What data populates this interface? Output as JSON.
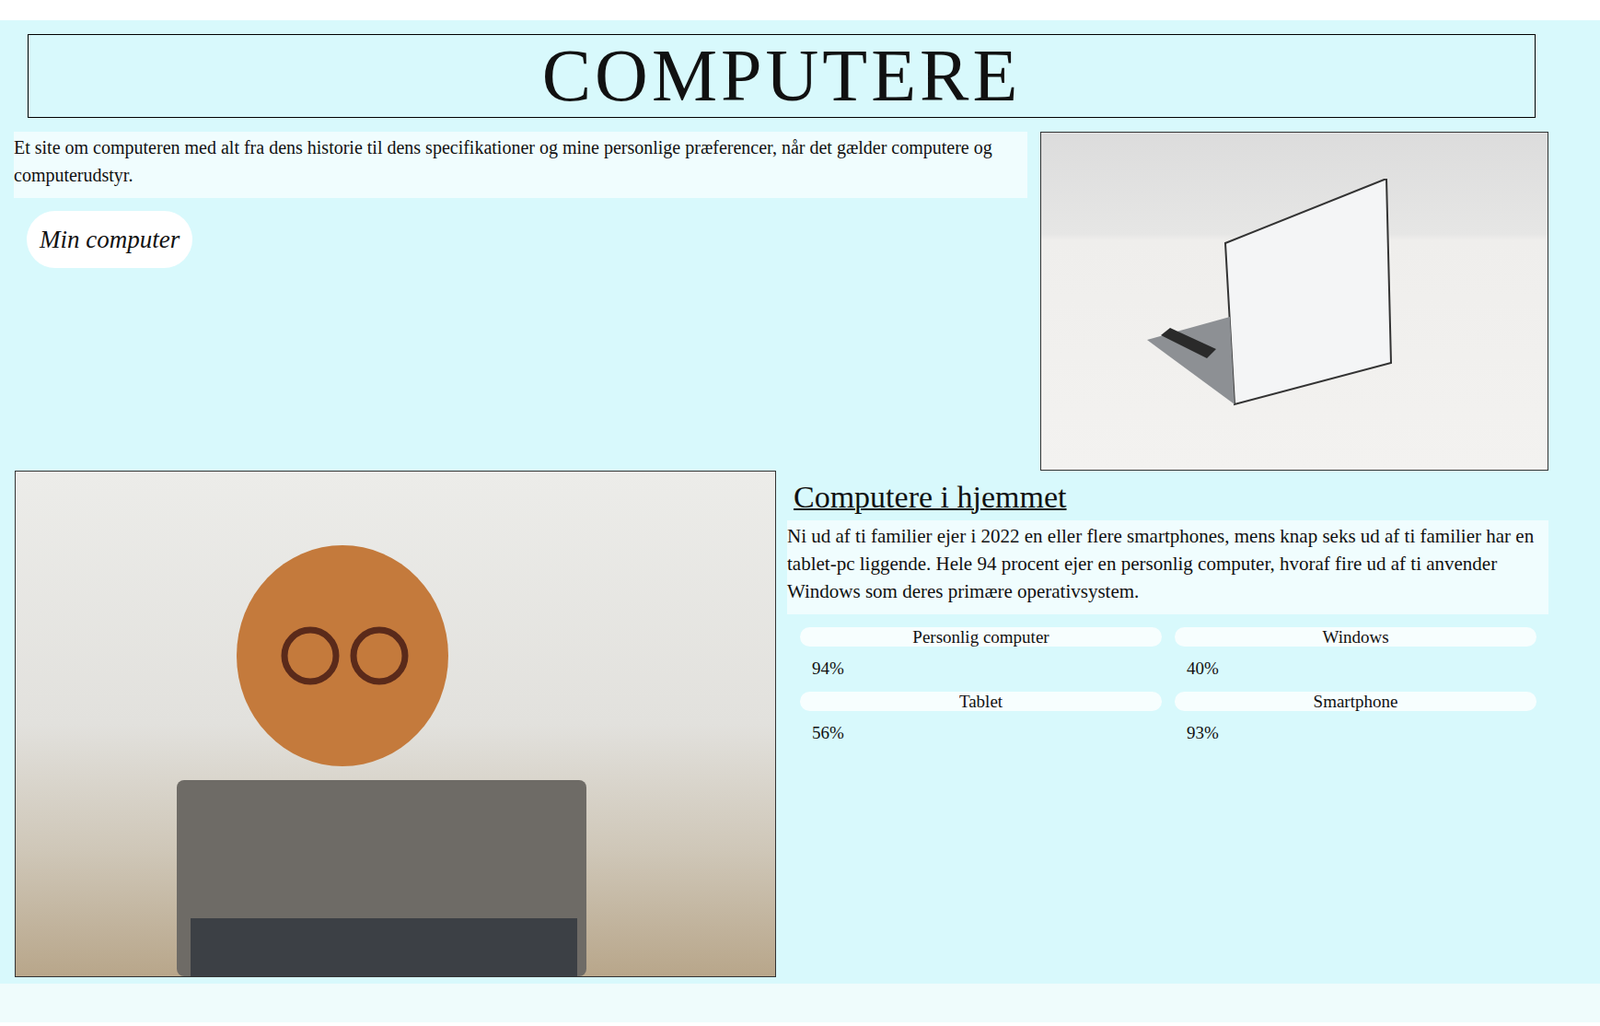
{
  "header": {
    "title": "COMPUTERE"
  },
  "intro": {
    "text": "Et site om computeren med alt fra dens historie til dens specifikationer og mine personlige præferencer, når det gælder computere og computerudstyr.",
    "button": "Min computer"
  },
  "section": {
    "heading": "Computere i hjemmet",
    "text": "Ni ud af ti familier ejer i 2022 en eller flere smartphones, mens knap seks ud af ti familier har en tablet-pc liggende. Hele 94 procent ejer en personlig computer, hvoraf fire ud af ti anvender Windows som deres primære operativsystem.",
    "stats": [
      {
        "label": "Personlig computer",
        "value": "94%"
      },
      {
        "label": "Windows",
        "value": "40%"
      },
      {
        "label": "Tablet",
        "value": "56%"
      },
      {
        "label": "Smartphone",
        "value": "93%"
      }
    ]
  }
}
